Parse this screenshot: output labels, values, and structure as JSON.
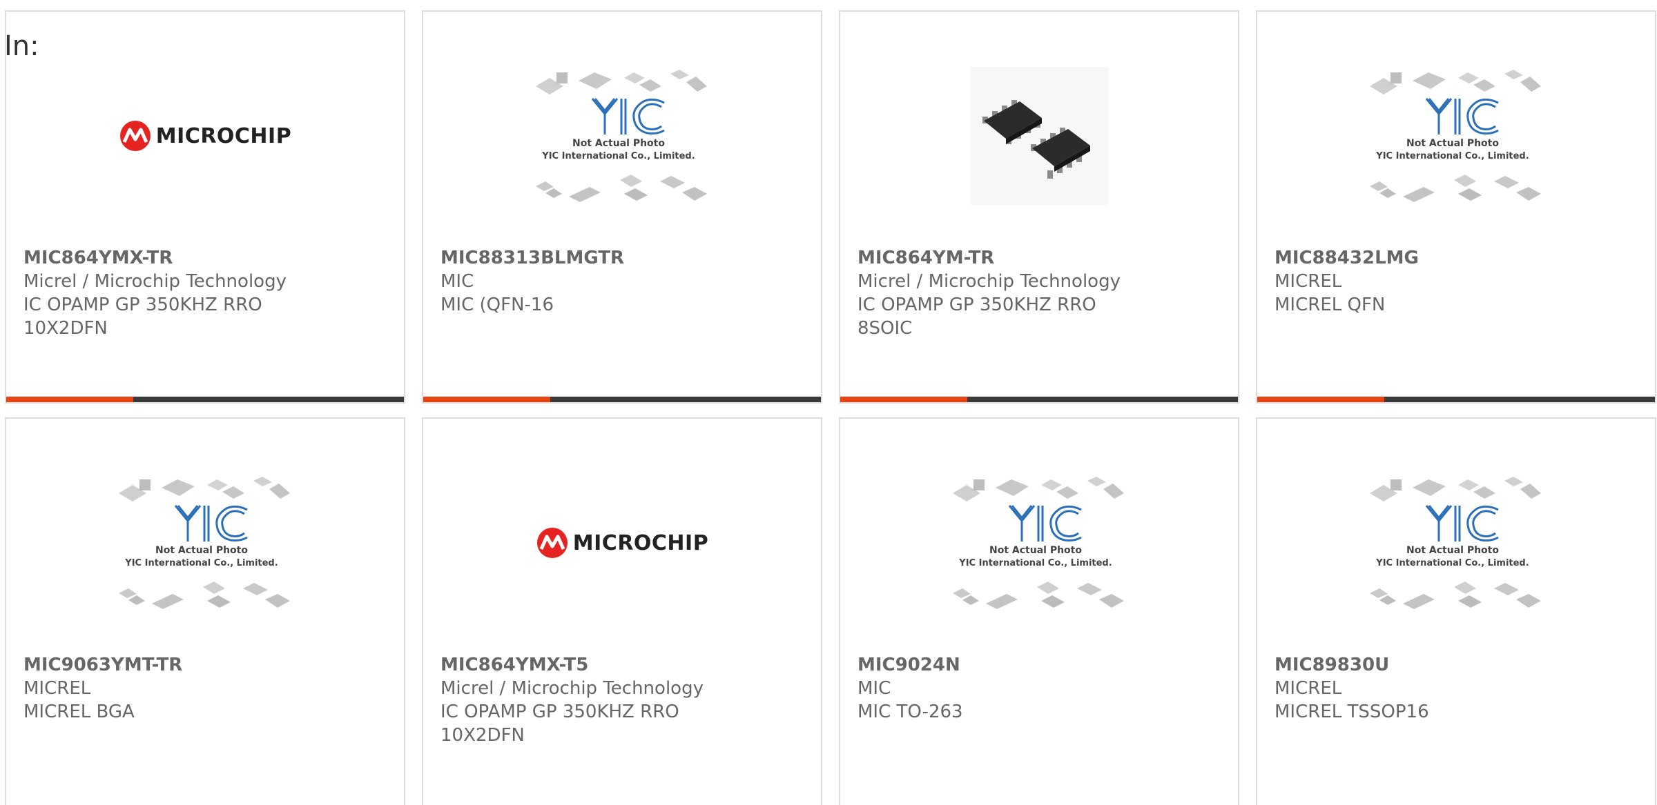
{
  "header": {
    "in_label": "In:"
  },
  "colors": {
    "accent": "#e8430f",
    "bar": "#3a3a3a",
    "yic_blue": "#2a6fb8",
    "microchip_red": "#e52421"
  },
  "products": [
    {
      "part_number": "MIC864YMX-TR",
      "manufacturer": "Micrel / Microchip Technology",
      "description": "IC OPAMP GP 350KHZ RRO 10X2DFN",
      "image": "microchip-logo"
    },
    {
      "part_number": "MIC88313BLMGTR",
      "manufacturer": "MIC",
      "description": "MIC (QFN-16",
      "image": "yic-placeholder",
      "placeholder_line1": "Not Actual Photo",
      "placeholder_line2": "YIC International Co., Limited."
    },
    {
      "part_number": "MIC864YM-TR",
      "manufacturer": "Micrel / Microchip Technology",
      "description": "IC OPAMP GP 350KHZ RRO 8SOIC",
      "image": "soic-chip-photo"
    },
    {
      "part_number": "MIC88432LMG",
      "manufacturer": "MICREL",
      "description": "MICREL QFN",
      "image": "yic-placeholder",
      "placeholder_line1": "Not Actual Photo",
      "placeholder_line2": "YIC International Co., Limited."
    },
    {
      "part_number": "MIC9063YMT-TR",
      "manufacturer": "MICREL",
      "description": "MICREL BGA",
      "image": "yic-placeholder",
      "placeholder_line1": "Not Actual Photo",
      "placeholder_line2": "YIC International Co., Limited."
    },
    {
      "part_number": "MIC864YMX-T5",
      "manufacturer": "Micrel / Microchip Technology",
      "description": "IC OPAMP GP 350KHZ RRO 10X2DFN",
      "image": "microchip-logo"
    },
    {
      "part_number": "MIC9024N",
      "manufacturer": "MIC",
      "description": "MIC TO-263",
      "image": "yic-placeholder",
      "placeholder_line1": "Not Actual Photo",
      "placeholder_line2": "YIC International Co., Limited."
    },
    {
      "part_number": "MIC89830U",
      "manufacturer": "MICREL",
      "description": "MICREL TSSOP16",
      "image": "yic-placeholder",
      "placeholder_line1": "Not Actual Photo",
      "placeholder_line2": "YIC International Co., Limited."
    }
  ],
  "microchip_logo_text": "MICROCHIP"
}
